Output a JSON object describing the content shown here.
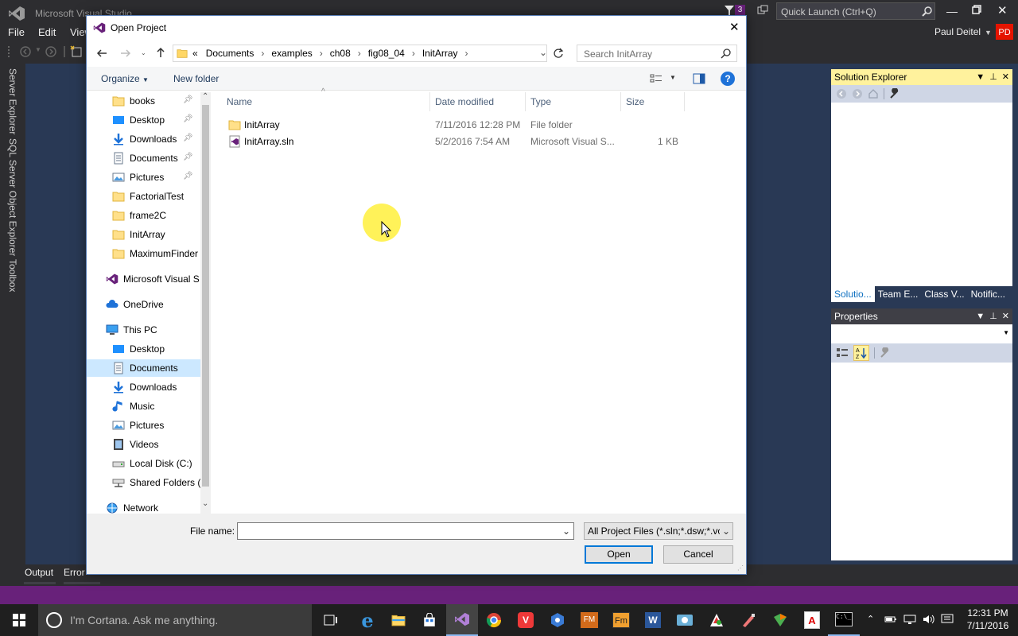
{
  "vs": {
    "title": "Microsoft Visual Studio",
    "notification_count": "3",
    "quick_launch_placeholder": "Quick Launch (Ctrl+Q)",
    "user_name": "Paul Deitel",
    "user_initials": "PD",
    "menu": [
      "File",
      "Edit",
      "View"
    ],
    "left_tabs": [
      "Server Explorer",
      "SQL Server Object Explorer",
      "Toolbox"
    ],
    "bottom_tabs": [
      "Output",
      "Error"
    ],
    "accent_color": "#68217a",
    "initials_color": "#e51400"
  },
  "solution_explorer": {
    "title": "Solution Explorer",
    "tabs": [
      "Solutio...",
      "Team E...",
      "Class V...",
      "Notific..."
    ]
  },
  "properties": {
    "title": "Properties"
  },
  "dialog": {
    "title": "Open Project",
    "breadcrumb": [
      "«",
      "Documents",
      "examples",
      "ch08",
      "fig08_04",
      "InitArray"
    ],
    "search_placeholder": "Search InitArray",
    "organize_label": "Organize",
    "new_folder_label": "New folder",
    "nav": {
      "quick_access": [
        {
          "label": "books",
          "icon": "folder-icon",
          "pinned": true
        },
        {
          "label": "Desktop",
          "icon": "desktop-icon",
          "pinned": true
        },
        {
          "label": "Downloads",
          "icon": "download-icon",
          "pinned": true
        },
        {
          "label": "Documents",
          "icon": "document-icon",
          "pinned": true
        },
        {
          "label": "Pictures",
          "icon": "pictures-icon",
          "pinned": true
        },
        {
          "label": "FactorialTest",
          "icon": "folder-icon",
          "pinned": false
        },
        {
          "label": "frame2C",
          "icon": "folder-icon",
          "pinned": false
        },
        {
          "label": "InitArray",
          "icon": "folder-icon",
          "pinned": false
        },
        {
          "label": "MaximumFinder",
          "icon": "folder-icon",
          "pinned": false
        }
      ],
      "microsoft_vs": "Microsoft Visual S",
      "onedrive": "OneDrive",
      "this_pc": "This PC",
      "this_pc_items": [
        {
          "label": "Desktop",
          "icon": "desktop-icon"
        },
        {
          "label": "Documents",
          "icon": "document-icon",
          "selected": true
        },
        {
          "label": "Downloads",
          "icon": "download-icon"
        },
        {
          "label": "Music",
          "icon": "music-icon"
        },
        {
          "label": "Pictures",
          "icon": "pictures-icon"
        },
        {
          "label": "Videos",
          "icon": "videos-icon"
        },
        {
          "label": "Local Disk (C:)",
          "icon": "disk-icon"
        },
        {
          "label": "Shared Folders (\\",
          "icon": "network-drive-icon"
        }
      ],
      "network": "Network"
    },
    "columns": [
      "Name",
      "Date modified",
      "Type",
      "Size"
    ],
    "files": [
      {
        "name": "InitArray",
        "date": "7/11/2016 12:28 PM",
        "type": "File folder",
        "size": "",
        "icon": "folder-icon"
      },
      {
        "name": "InitArray.sln",
        "date": "5/2/2016 7:54 AM",
        "type": "Microsoft Visual S...",
        "size": "1 KB",
        "icon": "vs-solution-icon"
      }
    ],
    "file_name_label": "File name:",
    "file_name_value": "",
    "filter_value": "All Project Files (*.sln;*.dsw;*.vc",
    "open_label": "Open",
    "cancel_label": "Cancel"
  },
  "taskbar": {
    "cortana_placeholder": "I'm Cortana. Ask me anything.",
    "time": "12:31 PM",
    "date": "7/11/2016"
  }
}
